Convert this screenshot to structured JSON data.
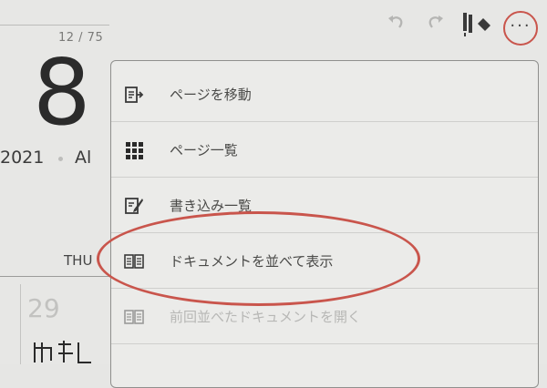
{
  "calendar": {
    "page_counter": "12 / 75",
    "day": "8",
    "year": "2021",
    "month_fragment": "Al",
    "weekday": "THU",
    "cell_number": "29"
  },
  "toolbar": {
    "undo_icon": "undo-icon",
    "redo_icon": "redo-icon",
    "pen_icon": "pen-eraser-icon",
    "more_icon": "more-dots-icon",
    "more_label": "···",
    "highlight_color": "#c9554c"
  },
  "menu": {
    "items": [
      {
        "label": "ページを移動",
        "icon": "page-move-icon",
        "enabled": true
      },
      {
        "label": "ページ一覧",
        "icon": "grid-icon",
        "enabled": true
      },
      {
        "label": "書き込み一覧",
        "icon": "edit-list-icon",
        "enabled": true
      },
      {
        "label": "ドキュメントを並べて表示",
        "icon": "side-by-side-icon",
        "enabled": true
      },
      {
        "label": "前回並べたドキュメントを開く",
        "icon": "side-by-side-icon",
        "enabled": false
      }
    ]
  }
}
